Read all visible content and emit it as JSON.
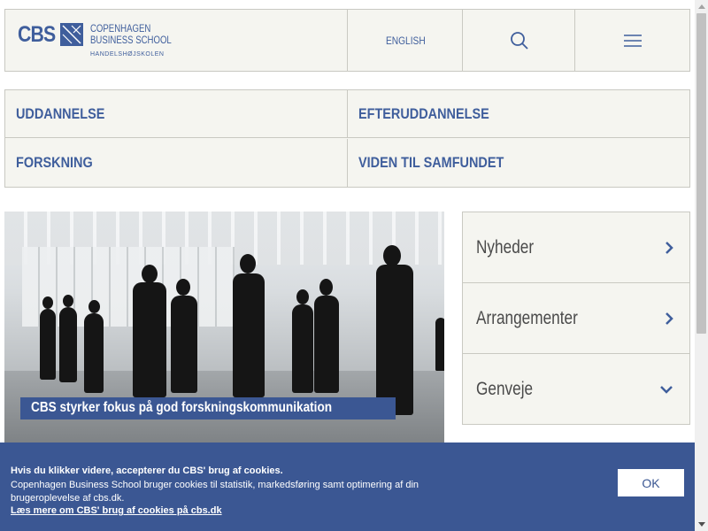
{
  "header": {
    "logo_abbrev": "CBS",
    "logo_line1": "COPENHAGEN",
    "logo_line2": "BUSINESS SCHOOL",
    "logo_line3": "HANDELSHØJSKOLEN",
    "language_label": "ENGLISH",
    "search_icon": "search-icon",
    "menu_icon": "hamburger-menu-icon"
  },
  "nav": {
    "items": [
      {
        "label": "UDDANNELSE"
      },
      {
        "label": "EFTERUDDANNELSE"
      },
      {
        "label": "FORSKNING"
      },
      {
        "label": "VIDEN TIL SAMFUNDET"
      }
    ]
  },
  "hero": {
    "caption": "CBS styrker fokus på god forskningskommunikation"
  },
  "side": {
    "items": [
      {
        "label": "Nyheder",
        "icon": "chevron-right-icon"
      },
      {
        "label": "Arrangementer",
        "icon": "chevron-right-icon"
      },
      {
        "label": "Genveje",
        "icon": "chevron-down-icon"
      }
    ]
  },
  "cookie": {
    "title": "Hvis du klikker videre, accepterer du CBS' brug af cookies.",
    "body": "Copenhagen Business School bruger cookies til statistik, markedsføring samt optimering af din brugeroplevelse af cbs.dk.",
    "link": "Læs mere om CBS' brug af cookies på cbs.dk",
    "ok_label": "OK"
  },
  "colors": {
    "brand_blue": "#3f5e9c",
    "banner_blue": "#3b5793",
    "panel_bg": "#f5f5f0",
    "border": "#c9c9c2"
  }
}
